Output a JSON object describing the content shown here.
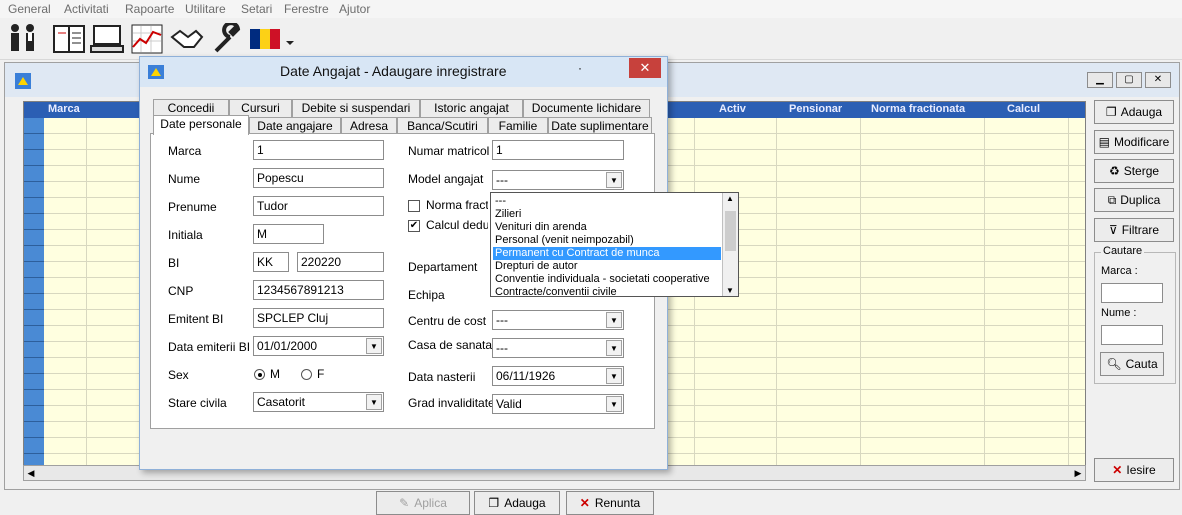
{
  "menu": [
    "General",
    "Activitati",
    "Rapoarte",
    "Utilitare",
    "Setari",
    "Ferestre",
    "Ajutor"
  ],
  "toolbar_icons": [
    "people-icon",
    "book-icon",
    "computer-icon",
    "chart-icon",
    "handshake-icon",
    "wrench-icon",
    "flag-icon"
  ],
  "grid": {
    "columns": [
      "Marca",
      "Activ",
      "Pensionar",
      "Norma fractionata",
      "Calcul"
    ]
  },
  "side": {
    "adauga": "Adauga",
    "modificare": "Modificare",
    "sterge": "Sterge",
    "duplica": "Duplica",
    "filtrare": "Filtrare",
    "cautare_title": "Cautare",
    "marca_label": "Marca :",
    "nume_label": "Nume :",
    "cauta": "Cauta",
    "iesire": "Iesire"
  },
  "dialog": {
    "title": "Date Angajat - Adaugare inregistrare",
    "tabs_top": [
      "Concedii",
      "Cursuri",
      "Debite si suspendari",
      "Istoric angajat",
      "Documente lichidare"
    ],
    "tabs_bottom": [
      "Date personale",
      "Date angajare",
      "Adresa",
      "Banca/Scutiri",
      "Familie",
      "Date suplimentare"
    ],
    "left": {
      "marca_label": "Marca",
      "marca_value": "1",
      "nume_label": "Nume",
      "nume_value": "Popescu",
      "prenume_label": "Prenume",
      "prenume_value": "Tudor",
      "initiala_label": "Initiala",
      "initiala_value": "M",
      "bi_label": "BI",
      "bi_serie": "KK",
      "bi_numar": "220220",
      "cnp_label": "CNP",
      "cnp_value": "1234567891213",
      "emitent_label": "Emitent BI",
      "emitent_value": "SPCLEP Cluj",
      "data_emiterii_label": "Data emiterii BI",
      "data_emiterii_value": "01/01/2000",
      "sex_label": "Sex",
      "sex_m": "M",
      "sex_f": "F",
      "stare_label": "Stare civila",
      "stare_value": "Casatorit"
    },
    "right": {
      "numar_label": "Numar matricol",
      "numar_value": "1",
      "model_label": "Model angajat",
      "model_value": "---",
      "norma_label": "Norma fractionata",
      "calcul_label": "Calcul deduceri",
      "departament_label": "Departament",
      "echipa_label": "Echipa",
      "centru_label": "Centru de cost",
      "centru_value": "---",
      "casa_label": "Casa de sanatate",
      "casa_value": "---",
      "nastere_label": "Data nasterii",
      "nastere_value": "06/11/1926",
      "grad_label": "Grad invaliditate",
      "grad_value": "Valid"
    },
    "dropdown_options": [
      "---",
      "Zilieri",
      "Venituri din arenda",
      "Personal (venit neimpozabil)",
      "Permanent cu Contract de munca",
      "Drepturi de autor",
      "Conventie individuala - societati cooperative",
      "Contracte/conventii civile"
    ],
    "selected_option": "Permanent cu Contract de munca",
    "buttons": {
      "aplica": "Aplica",
      "adauga": "Adauga",
      "renunta": "Renunta"
    }
  }
}
